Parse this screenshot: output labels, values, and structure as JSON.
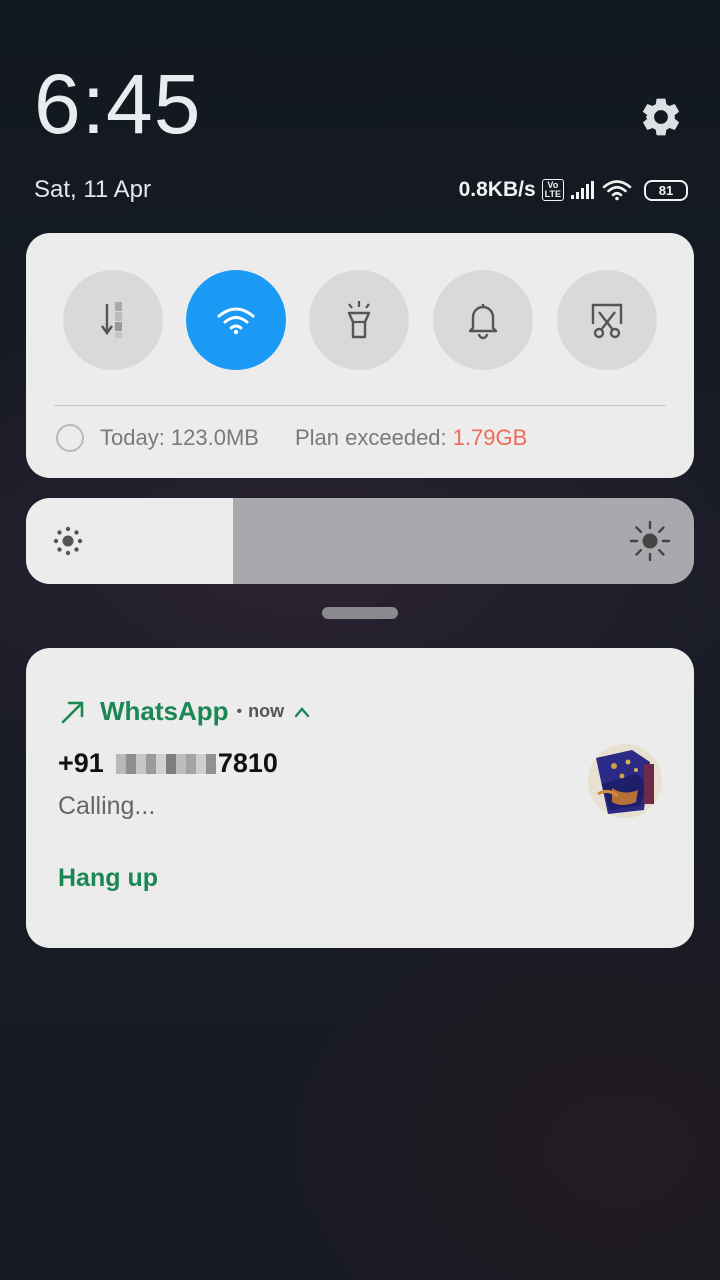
{
  "lockscreen": {
    "time": "6:45",
    "date": "Sat, 11 Apr"
  },
  "status_bar": {
    "speed": "0.8KB/s",
    "lte_top": "Vo",
    "lte_bottom": "LTE",
    "battery": "81",
    "icons": [
      "settings-gear-icon",
      "volte-icon",
      "signal-icon",
      "wifi-icon",
      "battery-icon"
    ]
  },
  "quick_settings": {
    "tiles": [
      {
        "name": "mobile-data",
        "icon": "mobile-data-icon",
        "active": false
      },
      {
        "name": "wifi",
        "icon": "wifi-icon",
        "active": true
      },
      {
        "name": "flashlight",
        "icon": "flashlight-icon",
        "active": false
      },
      {
        "name": "notification-bell",
        "icon": "bell-icon",
        "active": false
      },
      {
        "name": "screenshot",
        "icon": "scissors-screenshot-icon",
        "active": false
      }
    ],
    "data_usage": {
      "today": "Today: 123.0MB",
      "plan_label": "Plan exceeded:",
      "plan_value": "1.79GB"
    }
  },
  "brightness": {
    "level": 0.31,
    "icons": [
      "brightness-low-icon",
      "brightness-high-icon"
    ]
  },
  "notification": {
    "app": "WhatsApp",
    "separator": "•",
    "time": "now",
    "caller_prefix": "+91",
    "caller_suffix": "7810",
    "status": "Calling...",
    "action": "Hang up",
    "accent": "#1b8752",
    "icons": [
      "outgoing-call-arrow-icon",
      "chevron-up-icon",
      "contact-avatar"
    ]
  },
  "colors": {
    "wifi_active": "#1a9af5",
    "plan_exceeded": "#ef6a5a"
  }
}
